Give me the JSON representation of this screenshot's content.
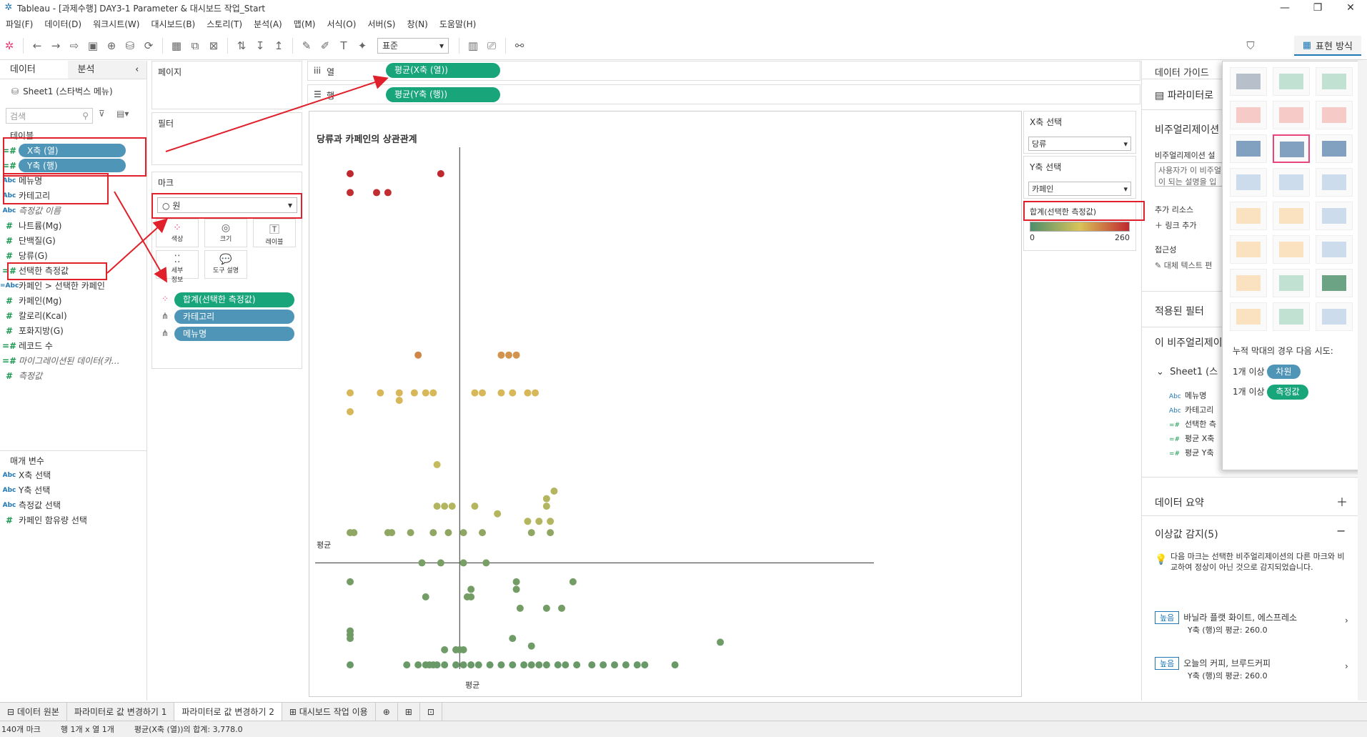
{
  "window": {
    "title": "Tableau - [과제수행] DAY3-1 Parameter & 대시보드 작업_Start"
  },
  "menu": [
    "파일(F)",
    "데이터(D)",
    "워크시트(W)",
    "대시보드(B)",
    "스토리(T)",
    "분석(A)",
    "맵(M)",
    "서식(O)",
    "서버(S)",
    "창(N)",
    "도움말(H)"
  ],
  "toolbar": {
    "fit": "표준",
    "showme": "표현 방식"
  },
  "datapane": {
    "tab_data": "데이터",
    "tab_analysis": "분석",
    "source": "Sheet1 (스타벅스 메뉴)",
    "search_placeholder": "검색",
    "tables_header": "테이블",
    "fields": [
      {
        "icon": "=#",
        "name": "X축 (열)"
      },
      {
        "icon": "=#",
        "name": "Y축 (행)"
      },
      {
        "icon": "Abc",
        "name": "메뉴명"
      },
      {
        "icon": "Abc",
        "name": "카테고리"
      },
      {
        "icon": "Abc",
        "name": "측정값 이름"
      },
      {
        "icon": "#",
        "name": "나트륨(Mg)"
      },
      {
        "icon": "#",
        "name": "단백질(G)"
      },
      {
        "icon": "#",
        "name": "당류(G)"
      },
      {
        "icon": "=#",
        "name": "선택한 측정값"
      },
      {
        "icon": "=Abc",
        "name": "카페인 > 선택한 카페인"
      },
      {
        "icon": "#",
        "name": "카페인(Mg)"
      },
      {
        "icon": "#",
        "name": "칼로리(Kcal)"
      },
      {
        "icon": "#",
        "name": "포화지방(G)"
      },
      {
        "icon": "=#",
        "name": "레코드 수"
      },
      {
        "icon": "=#",
        "name": "마이그레이션된 데이터(카..."
      },
      {
        "icon": "#",
        "name": "측정값"
      }
    ],
    "params_header": "매개 변수",
    "params": [
      {
        "icon": "Abc",
        "name": "X축 선택"
      },
      {
        "icon": "Abc",
        "name": "Y축 선택"
      },
      {
        "icon": "Abc",
        "name": "측정값 선택"
      },
      {
        "icon": "#",
        "name": "카페인 함유량 선택"
      }
    ]
  },
  "shelves": {
    "pages": "페이지",
    "filters": "필터",
    "marks": "마크",
    "mark_type": "원",
    "mark_buttons": [
      "색상",
      "크기",
      "레이블",
      "세부\n정보",
      "도구 설명"
    ],
    "mark_pills": [
      "합계(선택한 측정값)",
      "카테고리",
      "메뉴명"
    ],
    "columns_label": "열",
    "rows_label": "행",
    "columns_pill": "평균(X축 (열))",
    "rows_pill": "평균(Y축 (행))"
  },
  "view": {
    "title": "당류과 카페인의 상관관계",
    "avg_label_h": "평균",
    "avg_label_v": "평균"
  },
  "chart_data": {
    "type": "scatter",
    "title": "당류과 카페인의 상관관계",
    "xlabel": "",
    "ylabel": "",
    "xlim": [
      0,
      14
    ],
    "ylim": [
      0,
      14
    ],
    "avg_x": 3.6,
    "avg_y": 3.0,
    "color_range": [
      0,
      260
    ],
    "points": [
      [
        0.7,
        13.3,
        260
      ],
      [
        3.1,
        13.3,
        260
      ],
      [
        0.7,
        12.8,
        255
      ],
      [
        1.4,
        12.8,
        255
      ],
      [
        1.7,
        12.8,
        255
      ],
      [
        2.5,
        8.5,
        180
      ],
      [
        4.7,
        8.5,
        170
      ],
      [
        4.9,
        8.5,
        170
      ],
      [
        5.1,
        8.5,
        170
      ],
      [
        0.7,
        7.5,
        140
      ],
      [
        1.5,
        7.5,
        140
      ],
      [
        2.0,
        7.5,
        140
      ],
      [
        2.4,
        7.5,
        140
      ],
      [
        2.7,
        7.5,
        140
      ],
      [
        2.9,
        7.5,
        140
      ],
      [
        4.0,
        7.5,
        140
      ],
      [
        4.2,
        7.5,
        140
      ],
      [
        4.7,
        7.5,
        140
      ],
      [
        5.0,
        7.5,
        140
      ],
      [
        5.4,
        7.5,
        140
      ],
      [
        5.6,
        7.5,
        140
      ],
      [
        0.7,
        7.0,
        140
      ],
      [
        2.0,
        7.3,
        140
      ],
      [
        3.0,
        5.6,
        110
      ],
      [
        6.1,
        4.9,
        95
      ],
      [
        5.9,
        4.7,
        95
      ],
      [
        3.0,
        4.5,
        95
      ],
      [
        3.2,
        4.5,
        95
      ],
      [
        3.4,
        4.5,
        95
      ],
      [
        4.0,
        4.5,
        95
      ],
      [
        5.9,
        4.5,
        95
      ],
      [
        4.6,
        4.3,
        95
      ],
      [
        5.4,
        4.1,
        95
      ],
      [
        5.7,
        4.1,
        95
      ],
      [
        6.0,
        4.1,
        95
      ],
      [
        0.7,
        3.8,
        60
      ],
      [
        0.8,
        3.8,
        60
      ],
      [
        1.7,
        3.8,
        60
      ],
      [
        1.8,
        3.8,
        60
      ],
      [
        2.3,
        3.8,
        60
      ],
      [
        2.9,
        3.8,
        60
      ],
      [
        3.3,
        3.8,
        60
      ],
      [
        3.7,
        3.8,
        60
      ],
      [
        4.2,
        3.8,
        60
      ],
      [
        5.5,
        3.8,
        60
      ],
      [
        6.0,
        3.8,
        60
      ],
      [
        2.6,
        3.0,
        40
      ],
      [
        3.1,
        3.0,
        40
      ],
      [
        3.7,
        3.0,
        40
      ],
      [
        4.3,
        3.0,
        40
      ],
      [
        0.7,
        2.5,
        35
      ],
      [
        5.1,
        2.5,
        35
      ],
      [
        6.6,
        2.5,
        35
      ],
      [
        3.9,
        2.3,
        35
      ],
      [
        5.1,
        2.3,
        35
      ],
      [
        2.7,
        2.1,
        35
      ],
      [
        3.8,
        2.1,
        35
      ],
      [
        3.9,
        2.1,
        35
      ],
      [
        5.2,
        1.8,
        35
      ],
      [
        5.9,
        1.8,
        35
      ],
      [
        6.3,
        1.8,
        35
      ],
      [
        0.7,
        1.2,
        30
      ],
      [
        0.7,
        1.1,
        30
      ],
      [
        0.7,
        1.0,
        30
      ],
      [
        5.0,
        1.0,
        30
      ],
      [
        5.5,
        0.8,
        30
      ],
      [
        10.5,
        0.9,
        30
      ],
      [
        3.6,
        0.7,
        30
      ],
      [
        3.7,
        0.7,
        30
      ],
      [
        3.5,
        0.7,
        30
      ],
      [
        3.2,
        0.7,
        30
      ],
      [
        0.7,
        0.3,
        25
      ],
      [
        2.2,
        0.3,
        25
      ],
      [
        2.5,
        0.3,
        25
      ],
      [
        2.7,
        0.3,
        25
      ],
      [
        2.8,
        0.3,
        25
      ],
      [
        2.9,
        0.3,
        25
      ],
      [
        3.0,
        0.3,
        25
      ],
      [
        3.2,
        0.3,
        25
      ],
      [
        3.5,
        0.3,
        25
      ],
      [
        3.7,
        0.3,
        25
      ],
      [
        3.9,
        0.3,
        25
      ],
      [
        4.1,
        0.3,
        25
      ],
      [
        4.4,
        0.3,
        25
      ],
      [
        4.7,
        0.3,
        25
      ],
      [
        5.0,
        0.3,
        25
      ],
      [
        5.3,
        0.3,
        25
      ],
      [
        5.5,
        0.3,
        25
      ],
      [
        5.7,
        0.3,
        25
      ],
      [
        5.9,
        0.3,
        25
      ],
      [
        6.2,
        0.3,
        25
      ],
      [
        6.4,
        0.3,
        25
      ],
      [
        6.7,
        0.3,
        25
      ],
      [
        7.1,
        0.3,
        25
      ],
      [
        7.4,
        0.3,
        25
      ],
      [
        7.7,
        0.3,
        25
      ],
      [
        8.0,
        0.3,
        25
      ],
      [
        8.3,
        0.3,
        25
      ],
      [
        8.5,
        0.3,
        25
      ],
      [
        9.3,
        0.3,
        25
      ]
    ]
  },
  "param_cards": {
    "x_title": "X축 선택",
    "x_value": "당류",
    "y_title": "Y축 선택",
    "y_value": "카페인",
    "legend_title": "합계(선택한 측정값)",
    "legend_min": "0",
    "legend_max": "260",
    "legend_colors": [
      "#4f8f6b",
      "#d9c35a",
      "#c0282f"
    ]
  },
  "guide": {
    "title": "데이터 가이드",
    "parameter_label": "파라미터로",
    "viz_header": "비주얼리제이션",
    "viz_desc_label": "비주얼리제이션 설",
    "viz_desc_placeholder": "사용자가 이 비주얼리 이 되는 설명을 입",
    "resources_label": "추가 리소스",
    "add_link": "링크 추가",
    "access_label": "접근성",
    "alt_text": "대체 텍스트 편",
    "filters_applied": "적용된 필터",
    "this_viz": "이 비주얼리제이",
    "sheet_item": "Sheet1 (스",
    "viz_fields": [
      {
        "icon": "Abc",
        "name": "메뉴명"
      },
      {
        "icon": "Abc",
        "name": "카테고리"
      },
      {
        "icon": "=#",
        "name": "선택한 측"
      },
      {
        "icon": "=#",
        "name": "평균 X축"
      },
      {
        "icon": "=#",
        "name": "평균 Y축"
      }
    ],
    "data_summary": "데이터 요약",
    "outliers": "이상값 감지(5)",
    "outlier_desc": "다음 마크는 선택한 비주얼리제이션의 다른 마크와 비교하여 정상이 아닌 것으로 감지되었습니다.",
    "outlier_items": [
      {
        "badge": "높음",
        "name": "바닐라 플랫 화이트, 에스프레소",
        "detail": "Y축 (행)의 평균: 260.0"
      },
      {
        "badge": "높음",
        "name": "오늘의 커피, 브루드커피",
        "detail": "Y축 (행)의 평균: 260.0"
      }
    ]
  },
  "showme": {
    "hint": "누적 막대의 경우 다음 시도:",
    "hint_dim": "1개 이상",
    "dim_pill": "차원",
    "hint_meas": "1개 이상",
    "meas_pill": "측정값"
  },
  "tabs": [
    {
      "label": "데이터 원본",
      "icon": "⊟"
    },
    {
      "label": "파라미터로 값 변경하기 1",
      "icon": ""
    },
    {
      "label": "파라미터로 값 변경하기 2",
      "icon": ""
    },
    {
      "label": "대시보드 작업 이용",
      "icon": "⊞"
    }
  ],
  "status": {
    "marks": "140개 마크",
    "rows": "행 1개 x 열 1개",
    "sum": "평균(X축 (열))의 합계: 3,778.0"
  }
}
